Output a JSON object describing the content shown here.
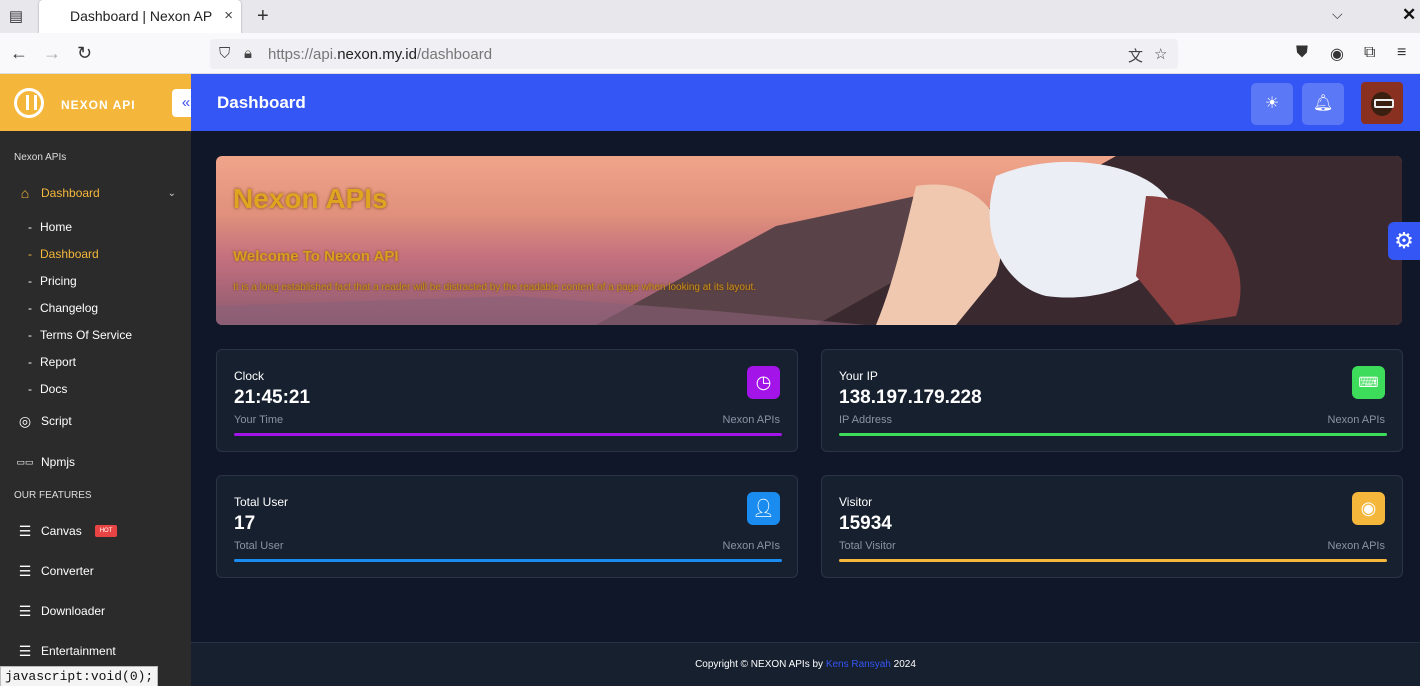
{
  "browser": {
    "tab_title": "Dashboard | Nexon AP",
    "tab_close": "×",
    "new_tab": "+",
    "url_scheme": "https://api.",
    "url_host": "nexon.my.id",
    "url_path": "/dashboard"
  },
  "sidebar": {
    "brand": "NEXON API",
    "section_main": "Nexon APIs",
    "dashboard": {
      "label": "Dashboard",
      "icon": "home-icon"
    },
    "sub_items": [
      {
        "label": "Home"
      },
      {
        "label": "Dashboard",
        "active": true
      },
      {
        "label": "Pricing"
      },
      {
        "label": "Changelog"
      },
      {
        "label": "Terms Of Service"
      },
      {
        "label": "Report"
      },
      {
        "label": "Docs"
      }
    ],
    "script": {
      "label": "Script",
      "icon": "github-icon"
    },
    "npmjs": {
      "label": "Npmjs",
      "icon": "npm-icon"
    },
    "section_features": "OUR FEATURES",
    "features": [
      {
        "label": "Canvas",
        "badge": "HOT",
        "icon": "layers-icon"
      },
      {
        "label": "Converter",
        "icon": "layers-icon"
      },
      {
        "label": "Downloader",
        "icon": "layers-icon"
      },
      {
        "label": "Entertainment",
        "icon": "layers-icon"
      }
    ]
  },
  "status_link": "javascript:void(0);",
  "topbar": {
    "title": "Dashboard"
  },
  "banner": {
    "title": "Nexon APIs",
    "subtitle": "Welcome To Nexon API",
    "description": "It is a long established fact that a reader will be distracted by the readable content of a page when looking at its layout."
  },
  "cards": [
    {
      "label": "Clock",
      "value": "21:45:21",
      "sub": "Your Time",
      "source": "Nexon APIs",
      "color": "#a214e8",
      "icon": "clock-icon"
    },
    {
      "label": "Your IP",
      "value": "138.197.179.228",
      "sub": "IP Address",
      "source": "Nexon APIs",
      "color": "#3ddc5a",
      "icon": "keyboard-icon"
    },
    {
      "label": "Total User",
      "value": "17",
      "sub": "Total User",
      "source": "Nexon APIs",
      "color": "#1a8cf0",
      "icon": "user-icon"
    },
    {
      "label": "Visitor",
      "value": "15934",
      "sub": "Total Visitor",
      "source": "Nexon APIs",
      "color": "#f5b73b",
      "icon": "eye-icon"
    }
  ],
  "footer": {
    "prefix": "Copyright © NEXON APIs by ",
    "author": "Kens Ransyah",
    "suffix": " 2024"
  },
  "colors": {
    "accent": "#3456f5",
    "brand": "#f5b73b"
  }
}
